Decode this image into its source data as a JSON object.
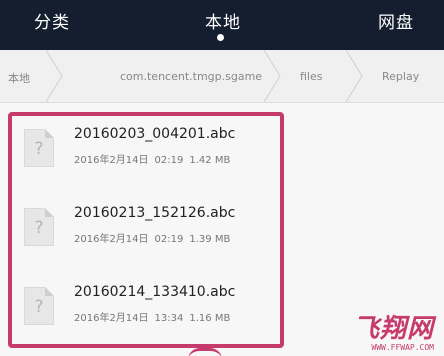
{
  "tabs": {
    "items": [
      {
        "label": "分类"
      },
      {
        "label": "本地"
      },
      {
        "label": "网盘"
      }
    ],
    "active_index": 1
  },
  "breadcrumb": {
    "items": [
      {
        "label": "本地"
      },
      {
        "label": "com.tencent.tmgp.sgame"
      },
      {
        "label": "files"
      },
      {
        "label": "Replay"
      }
    ]
  },
  "files": [
    {
      "name": "20160203_004201.abc",
      "date": "2016年2月14日",
      "time": "02:19",
      "size": "1.42 MB",
      "icon": "unknown-file-icon"
    },
    {
      "name": "20160213_152126.abc",
      "date": "2016年2月14日",
      "time": "02:19",
      "size": "1.39 MB",
      "icon": "unknown-file-icon"
    },
    {
      "name": "20160214_133410.abc",
      "date": "2016年2月14日",
      "time": "13:34",
      "size": "1.16 MB",
      "icon": "unknown-file-icon"
    }
  ],
  "file_icon_glyph": "?",
  "highlight_color": "#c63a6c",
  "topbar_color": "#141e2e",
  "watermark": {
    "logo": "飞翔网",
    "url": "WWW.FFWAP.COM"
  }
}
